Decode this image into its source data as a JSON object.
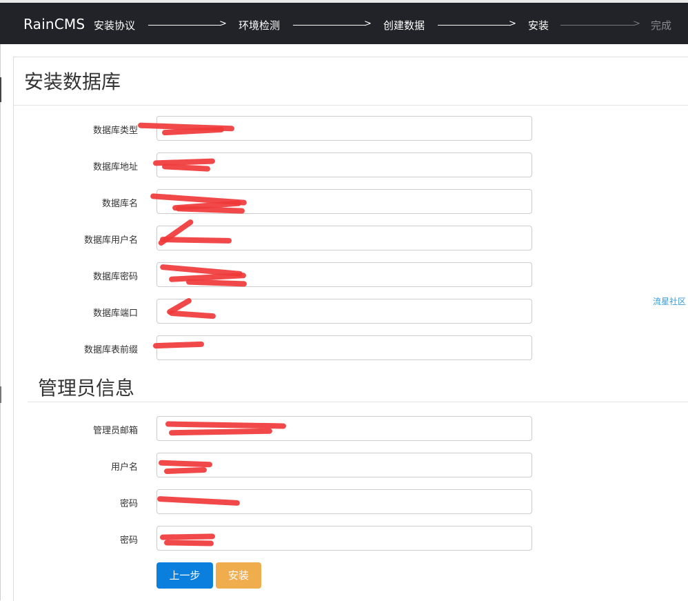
{
  "nav": {
    "brand": "RainCMS",
    "steps": [
      {
        "label": "安装协议",
        "active": true
      },
      {
        "label": "环境检测",
        "active": true
      },
      {
        "label": "创建数据",
        "active": true
      },
      {
        "label": "安装",
        "active": true
      },
      {
        "label": "完成",
        "active": false
      }
    ]
  },
  "database_section": {
    "title": "安装数据库",
    "fields": [
      {
        "label": "数据库类型",
        "value": ""
      },
      {
        "label": "数据库地址",
        "value": ""
      },
      {
        "label": "数据库名",
        "value": ""
      },
      {
        "label": "数据库用户名",
        "value": ""
      },
      {
        "label": "数据库密码",
        "value": ""
      },
      {
        "label": "数据库端口",
        "value": ""
      },
      {
        "label": "数据库表前缀",
        "value": ""
      }
    ]
  },
  "admin_section": {
    "title": "管理员信息",
    "fields": [
      {
        "label": "管理员邮箱",
        "value": ""
      },
      {
        "label": "用户名",
        "value": ""
      },
      {
        "label": "密码",
        "value": ""
      },
      {
        "label": "密码",
        "value": ""
      }
    ]
  },
  "sidelink": "流星社区",
  "buttons": {
    "prev": "上一步",
    "install": "安装"
  },
  "colors": {
    "navbar_bg": "#222328",
    "primary": "#0a7fde",
    "warning": "#f0ad4e",
    "redaction": "#f03a3a",
    "link": "#3a9bd9"
  }
}
